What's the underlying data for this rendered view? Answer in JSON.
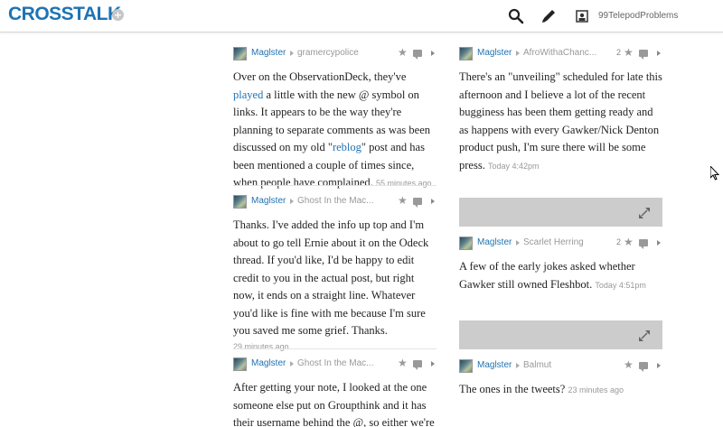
{
  "header": {
    "logo": "CROSSTALK",
    "username": "99TelepodProblems",
    "icons": [
      "search-icon",
      "pencil-icon",
      "profile-icon"
    ]
  },
  "left": {
    "posts": [
      {
        "author": "Maglster",
        "reply_to": "gramercypolice",
        "text_a": "Over on the ObservationDeck, they've ",
        "link": "played",
        "text_b": " a little with the new @ symbol on links. It appears to be the way they're planning to separate comments as was been discussed on my old \"",
        "link2": "reblog",
        "text_c": "\" post and has been mentioned a couple of times since, when people have complained.",
        "timestamp": "55 minutes ago"
      },
      {
        "author": "Maglster",
        "reply_to": "Ghost In the Mac...",
        "text": "Thanks. I've added the info up top and I'm about to go tell Ernie about it on the Odeck thread. If you'd like, I'd be happy to edit credit to you in the actual post, but right now, it ends on a straight line. Whatever you'd like is fine with me because I'm sure you saved me some grief. Thanks.",
        "timestamp": "29 minutes ago"
      },
      {
        "author": "Maglster",
        "reply_to": "Ghost In the Mac...",
        "text": "After getting your note, I looked at the one someone else put on Groupthink and it has their username behind the @, so either we're"
      }
    ]
  },
  "right": {
    "posts": [
      {
        "author": "Maglster",
        "reply_to": "AfroWithaChanc...",
        "likes": "2",
        "text": "There's an \"unveiling\" scheduled for late this afternoon and I believe a lot of the recent bugginess has been them getting ready and as happens with every Gawker/Nick Denton product push, I'm sure there will be some press.",
        "timestamp": "Today 4:42pm"
      },
      {
        "author": "Maglster",
        "reply_to": "Scarlet Herring",
        "likes": "2",
        "text": "A few of the early jokes asked whether Gawker still owned Fleshbot.",
        "timestamp": "Today 4:51pm"
      },
      {
        "author": "Maglster",
        "reply_to": "Balmut",
        "text": "The ones in the tweets?",
        "timestamp": "23 minutes ago"
      }
    ]
  },
  "colors": {
    "accent": "#1e73b4",
    "bar": "#cccccc"
  }
}
